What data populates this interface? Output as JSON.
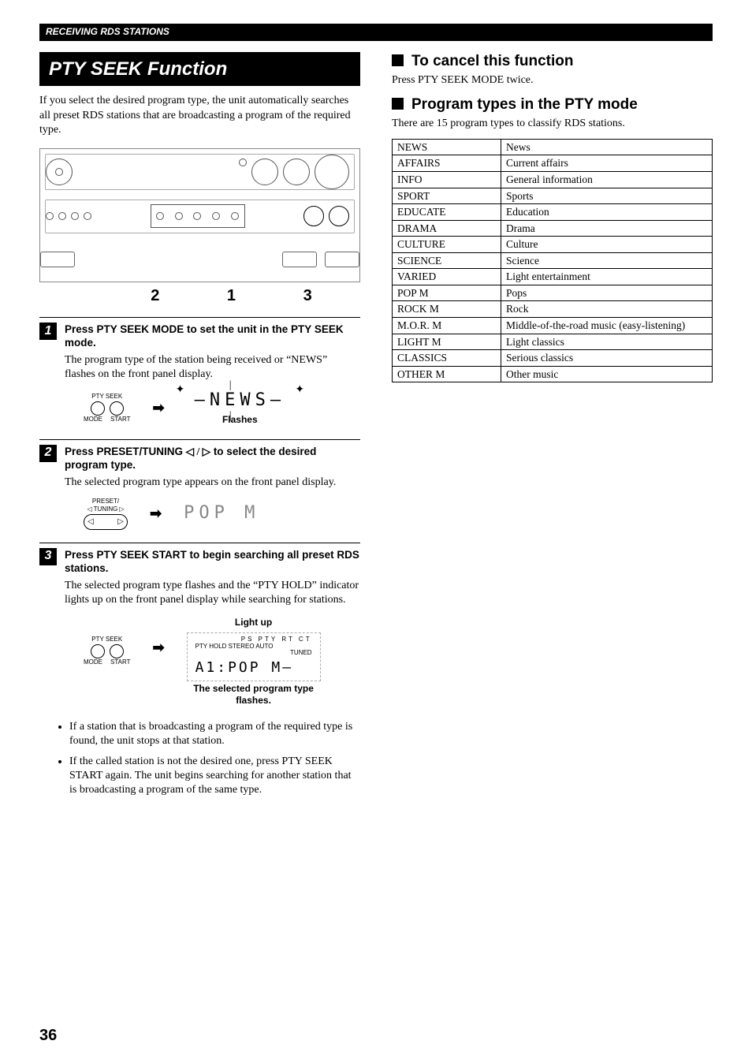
{
  "header": {
    "section_label": "RECEIVING RDS STATIONS"
  },
  "left": {
    "title": "PTY SEEK Function",
    "intro": "If you select the desired program type, the unit automatically searches all preset RDS stations that are broadcasting a program of the required type.",
    "hint_numbers": "213",
    "steps": [
      {
        "n": "1",
        "title": "Press PTY SEEK MODE to set the unit in the PTY SEEK mode.",
        "desc": "The program type of the station being received or “NEWS” flashes on the front panel display.",
        "btn_top": "PTY SEEK",
        "btn_left": "MODE",
        "btn_right": "START",
        "display": "NEWS",
        "flash_label": "Flashes"
      },
      {
        "n": "2",
        "title_prefix": "Press PRESET/TUNING ",
        "title_suffix": " to select the desired program type.",
        "desc": "The selected program type appears on the front panel display.",
        "btn_top": "PRESET/",
        "btn_top2": "TUNING",
        "display": "POP  M"
      },
      {
        "n": "3",
        "title": "Press PTY SEEK START to begin searching all preset RDS stations.",
        "desc": "The selected program type flashes and the “PTY HOLD” indicator lights up on the front panel display while searching for stations.",
        "btn_top": "PTY SEEK",
        "btn_left": "MODE",
        "btn_right": "START",
        "lightup_label": "Light up",
        "indicator_line": "PS  PTY  RT  CT",
        "indicator_sub": "PTY HOLD        STEREO AUTO",
        "indicator_tuned": "TUNED",
        "display": "A1:POP  M",
        "flash_label": "The selected program type flashes."
      }
    ],
    "bullets": [
      "If a station that is broadcasting a program of the required type is found, the unit stops at that station.",
      "If the called station is not the desired one, press PTY SEEK START again. The unit begins searching for another station that is broadcasting a program of the same type."
    ]
  },
  "right": {
    "cancel_title": "To cancel this function",
    "cancel_desc": "Press PTY SEEK MODE twice.",
    "pty_title": "Program types in the PTY mode",
    "pty_desc": "There are 15 program types to classify RDS stations.",
    "table": [
      [
        "NEWS",
        "News"
      ],
      [
        "AFFAIRS",
        "Current affairs"
      ],
      [
        "INFO",
        "General information"
      ],
      [
        "SPORT",
        "Sports"
      ],
      [
        "EDUCATE",
        "Education"
      ],
      [
        "DRAMA",
        "Drama"
      ],
      [
        "CULTURE",
        "Culture"
      ],
      [
        "SCIENCE",
        "Science"
      ],
      [
        "VARIED",
        "Light entertainment"
      ],
      [
        "POP M",
        "Pops"
      ],
      [
        "ROCK M",
        "Rock"
      ],
      [
        "M.O.R. M",
        "Middle-of-the-road music (easy-listening)"
      ],
      [
        "LIGHT M",
        "Light classics"
      ],
      [
        "CLASSICS",
        "Serious classics"
      ],
      [
        "OTHER M",
        "Other music"
      ]
    ]
  },
  "page_number": "36"
}
